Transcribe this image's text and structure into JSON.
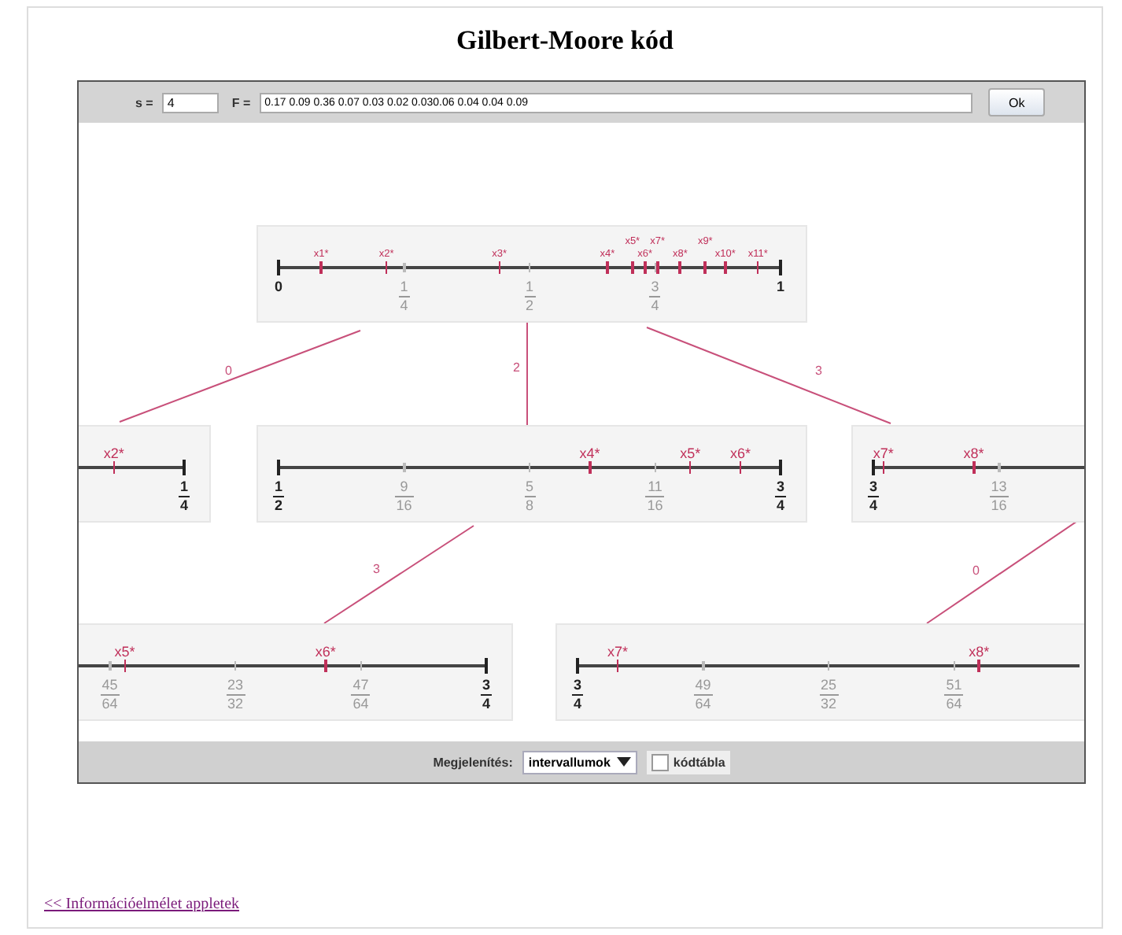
{
  "title": "Gilbert-Moore kód",
  "toolbar": {
    "s_label": "s =",
    "s_value": "4",
    "f_label": "F =",
    "f_value": "0.17 0.09 0.36 0.07 0.03 0.02 0.030.06 0.04 0.04 0.09",
    "ok_button": "Ok"
  },
  "nodes": [
    {
      "ticks": [
        {
          "num": "0",
          "kind": "end",
          "level": 0
        },
        {
          "num": "1",
          "den": "4",
          "kind": "mid",
          "level": 0.25
        },
        {
          "num": "1",
          "den": "2",
          "kind": "mid",
          "level": 0.5
        },
        {
          "num": "3",
          "den": "4",
          "kind": "mid",
          "level": 0.75
        },
        {
          "num": "1",
          "kind": "end",
          "level": 1
        }
      ],
      "marks": [
        {
          "label": "x1*",
          "level": 0.085
        },
        {
          "label": "x2*",
          "level": 0.215
        },
        {
          "label": "x3*",
          "level": 0.44
        },
        {
          "label": "x4*",
          "level": 0.655
        },
        {
          "label": "x5*",
          "level": 0.705
        },
        {
          "label": "x6*",
          "level": 0.73
        },
        {
          "label": "x7*",
          "level": 0.755
        },
        {
          "label": "x8*",
          "level": 0.8
        },
        {
          "label": "x9*",
          "level": 0.85
        },
        {
          "label": "x10*",
          "level": 0.89
        },
        {
          "label": "x11*",
          "level": 0.955
        }
      ]
    },
    {
      "ticks": [
        {
          "num": "1",
          "den": "4",
          "kind": "end",
          "level": 1
        }
      ],
      "marks": [
        {
          "label": "x2*",
          "level": 0.86
        }
      ]
    },
    {
      "ticks": [
        {
          "num": "1",
          "den": "2",
          "kind": "end",
          "level": 0
        },
        {
          "num": "9",
          "den": "16",
          "kind": "mid",
          "level": 0.25
        },
        {
          "num": "5",
          "den": "8",
          "kind": "mid",
          "level": 0.5
        },
        {
          "num": "11",
          "den": "16",
          "kind": "mid",
          "level": 0.75
        },
        {
          "num": "3",
          "den": "4",
          "kind": "end",
          "level": 1
        }
      ],
      "marks": [
        {
          "label": "x4*",
          "level": 0.62
        },
        {
          "label": "x5*",
          "level": 0.82
        },
        {
          "label": "x6*",
          "level": 0.92
        }
      ]
    },
    {
      "ticks": [
        {
          "num": "3",
          "den": "4",
          "kind": "end",
          "level": 0
        },
        {
          "num": "13",
          "den": "16",
          "kind": "mid",
          "level": 0.25
        }
      ],
      "marks": [
        {
          "label": "x7*",
          "level": 0.02
        },
        {
          "label": "x8*",
          "level": 0.2
        }
      ]
    },
    {
      "ticks": [
        {
          "num": "45",
          "den": "64",
          "kind": "mid",
          "level": 0.25
        },
        {
          "num": "23",
          "den": "32",
          "kind": "mid",
          "level": 0.5
        },
        {
          "num": "47",
          "den": "64",
          "kind": "mid",
          "level": 0.75
        },
        {
          "num": "3",
          "den": "4",
          "kind": "end",
          "level": 1
        }
      ],
      "marks": [
        {
          "label": "x5*",
          "level": 0.28
        },
        {
          "label": "x6*",
          "level": 0.68
        }
      ]
    },
    {
      "ticks": [
        {
          "num": "3",
          "den": "4",
          "kind": "end",
          "level": 0
        },
        {
          "num": "49",
          "den": "64",
          "kind": "mid",
          "level": 0.25
        },
        {
          "num": "25",
          "den": "32",
          "kind": "mid",
          "level": 0.5
        },
        {
          "num": "51",
          "den": "64",
          "kind": "mid",
          "level": 0.75
        }
      ],
      "marks": [
        {
          "label": "x7*",
          "level": 0.08
        },
        {
          "label": "x8*",
          "level": 0.8
        }
      ]
    }
  ],
  "edges": [
    {
      "label": "0"
    },
    {
      "label": "2"
    },
    {
      "label": "3"
    },
    {
      "label": "3"
    },
    {
      "label": "0"
    }
  ],
  "bottom_bar": {
    "display_label": "Megjelenítés:",
    "display_value": "intervallumok",
    "code_table": {
      "label": "kódtábla",
      "checked": false
    }
  },
  "link": "<< Információelmélet appletek"
}
